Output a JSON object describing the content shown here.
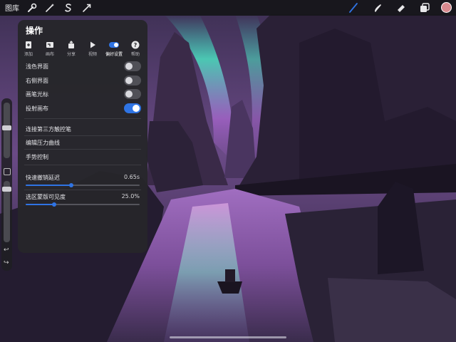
{
  "toolbar": {
    "gallery_label": "图库",
    "left_icons": [
      "wrench-icon",
      "magic-wand-icon",
      "selection-s-icon",
      "transform-arrow-icon"
    ],
    "right_icons": [
      "brush-icon",
      "smudge-icon",
      "eraser-icon",
      "layers-icon"
    ],
    "accent_color": "#2f74e4",
    "current_color": "#d98a8f"
  },
  "panel": {
    "title": "操作",
    "tabs": [
      {
        "label": "添加",
        "icon": "add-file-icon"
      },
      {
        "label": "画布",
        "icon": "canvas-icon"
      },
      {
        "label": "分享",
        "icon": "share-icon"
      },
      {
        "label": "视频",
        "icon": "play-icon"
      },
      {
        "label": "偏好设置",
        "icon": "toggle-icon",
        "active": true
      },
      {
        "label": "帮助",
        "icon": "help-icon"
      }
    ],
    "toggles": [
      {
        "label": "浅色界面",
        "on": false
      },
      {
        "label": "右侧界面",
        "on": false
      },
      {
        "label": "画笔光标",
        "on": false
      },
      {
        "label": "投射画布",
        "on": true
      }
    ],
    "links": [
      "连接第三方触控笔",
      "编辑压力曲线",
      "手势控制"
    ],
    "sliders": [
      {
        "label": "快速撤销延迟",
        "value": "0.65s",
        "fraction": 0.4
      },
      {
        "label": "选区蒙版可见度",
        "value": "25.0%",
        "fraction": 0.25
      }
    ]
  }
}
